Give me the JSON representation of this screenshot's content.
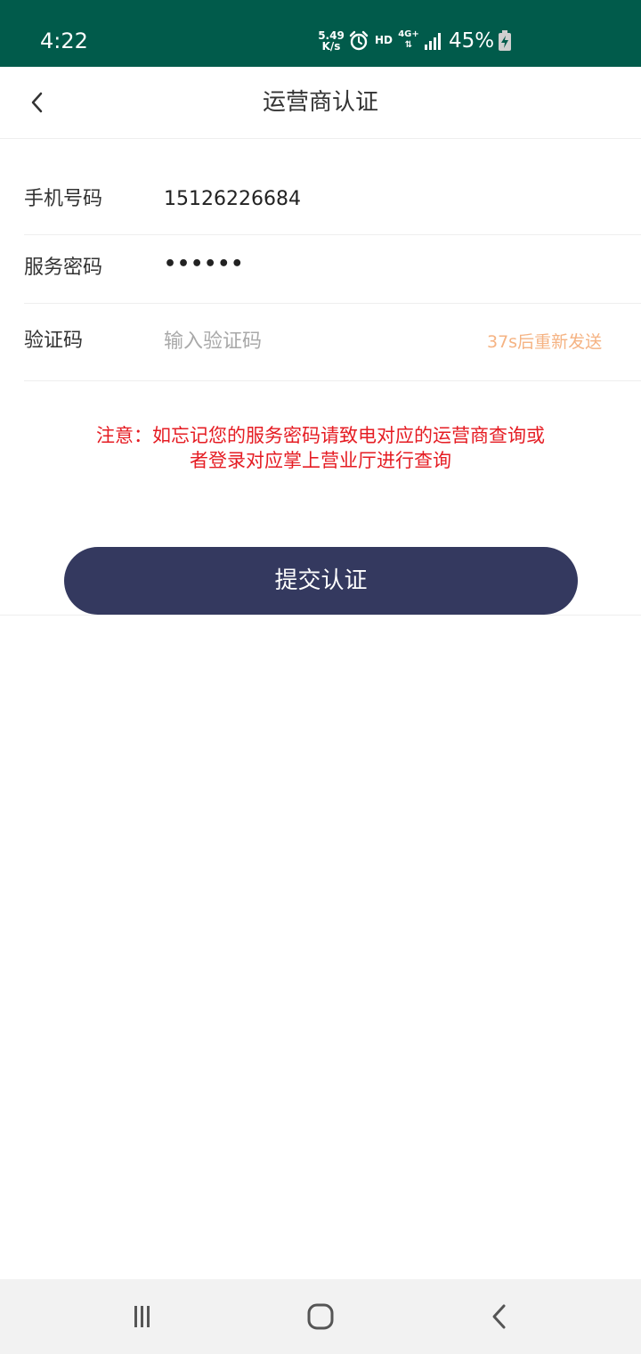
{
  "status_bar": {
    "time": "4:22",
    "speed_value": "5.49",
    "speed_unit": "K/s",
    "hd": "HD",
    "network": "4G+",
    "battery": "45%",
    "icons": [
      "alarm-icon",
      "signal-icon",
      "battery-charging-icon"
    ]
  },
  "header": {
    "title": "运营商认证",
    "back_icon": "chevron-left-icon"
  },
  "form": {
    "phone_label": "手机号码",
    "phone_value": "15126226684",
    "password_label": "服务密码",
    "password_value": "••••••",
    "code_label": "验证码",
    "code_placeholder": "输入验证码",
    "resend_text": "37s后重新发送"
  },
  "notice": {
    "line1": "注意：如忘记您的服务密码请致电对应的运营商查询或",
    "line2": "者登录对应掌上营业厅进行查询"
  },
  "submit_label": "提交认证",
  "colors": {
    "status_bar": "#015b4b",
    "button": "#34395f",
    "notice": "#e51c23",
    "countdown": "#f5b383"
  }
}
